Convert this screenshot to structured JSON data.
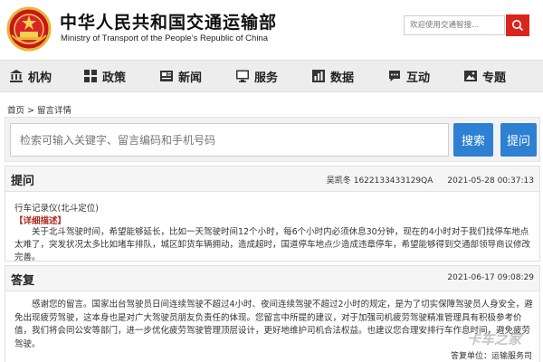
{
  "header": {
    "title_cn": "中华人民共和国交通运输部",
    "title_en": "Ministry of Transport of the People’s Republic of China",
    "search_placeholder": "欢迎使用交通智搜..."
  },
  "nav": {
    "items": [
      {
        "label": "机构",
        "icon": "building-icon"
      },
      {
        "label": "政策",
        "icon": "policy-grid-icon"
      },
      {
        "label": "新闻",
        "icon": "newspaper-icon"
      },
      {
        "label": "服务",
        "icon": "monitor-icon"
      },
      {
        "label": "数据",
        "icon": "bar-chart-icon"
      },
      {
        "label": "互动",
        "icon": "chat-bubble-icon"
      },
      {
        "label": "专题",
        "icon": "image-icon"
      }
    ]
  },
  "breadcrumb": {
    "home": "首页",
    "separator": " > ",
    "current": "留言详情"
  },
  "search": {
    "placeholder": "检索可输入关键字、留言编码和手机号码",
    "search_label": "搜索",
    "ask_label": "提问"
  },
  "question": {
    "title": "提问",
    "author": "吴凯冬",
    "code": "1622133433129QA",
    "datetime": "2021-05-28 00:37:13",
    "subject": "行车记录仪(北斗定位)",
    "detail_label": "【详细描述】",
    "body": "关于北斗驾驶时间，希望能够延长，比如一天驾驶时间12个小时，每6个小时内必须休息30分钟，现在的4小时对于我们找停车地点太难了，突发状况太多比如堵车排队，城区卸货车辆拥动，造成超时，国道停车地点少造成违章停车，希望能够得到交通部领导商议修改完善。"
  },
  "reply": {
    "title": "答复",
    "datetime": "2021-06-17 09:08:29",
    "body": "感谢您的留言。国家出台驾驶员日间连续驾驶不超过4小时、夜间连续驾驶不超过2小时的规定，是为了切实保障驾驶员人身安全，避免出现疲劳驾驶，这本身也是对广大驾驶员朋友负责任的体现。您留言中所提的建议，对于加强司机疲劳驾驶精准管理具有积极参考价值，我们将会同公安等部门，进一步优化疲劳驾驶管理顶层设计，更好地维护司机合法权益。也建议您合理安排行车作息时间，避免疲劳驾驶。",
    "footer": "答复单位：运输服务司"
  },
  "watermark": "卡车之家",
  "colors": {
    "accent_red": "#d9251c",
    "button_blue": "#2d80d2",
    "label_red": "#b02a1e"
  }
}
